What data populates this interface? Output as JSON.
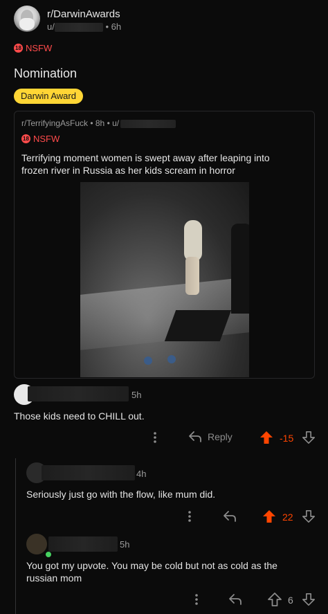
{
  "post": {
    "subreddit": "r/DarwinAwards",
    "author_prefix": "u/",
    "time": "• 6h",
    "nsfw_label": "NSFW",
    "nsfw_badge": "18",
    "title": "Nomination",
    "flair": "Darwin Award",
    "flair_color": "#ffd635"
  },
  "crosspost": {
    "meta": "r/TerrifyingAsFuck • 8h • u/",
    "nsfw_label": "NSFW",
    "nsfw_badge": "18",
    "title": "Terrifying moment women is swept away after leaping into frozen river in Russia as her kids scream in horror"
  },
  "comments": [
    {
      "time": "5h",
      "text": "Those kids need to CHILL out.",
      "reply_label": "Reply",
      "score": "-15",
      "vote_state": "upvoted"
    },
    {
      "time": "4h",
      "text": "Seriously just go with the flow, like mum did.",
      "score": "22",
      "vote_state": "upvoted"
    },
    {
      "time": "5h",
      "text": "You got my upvote. You may be cold but not as cold as the russian mom",
      "score": "6",
      "vote_state": "none"
    }
  ],
  "colors": {
    "accent_orange": "#ff4500",
    "nsfw_red": "#ff4b4b",
    "online_green": "#46d160"
  },
  "icons": [
    "more-vertical-icon",
    "reply-arrow-icon",
    "upvote-icon",
    "downvote-icon"
  ]
}
